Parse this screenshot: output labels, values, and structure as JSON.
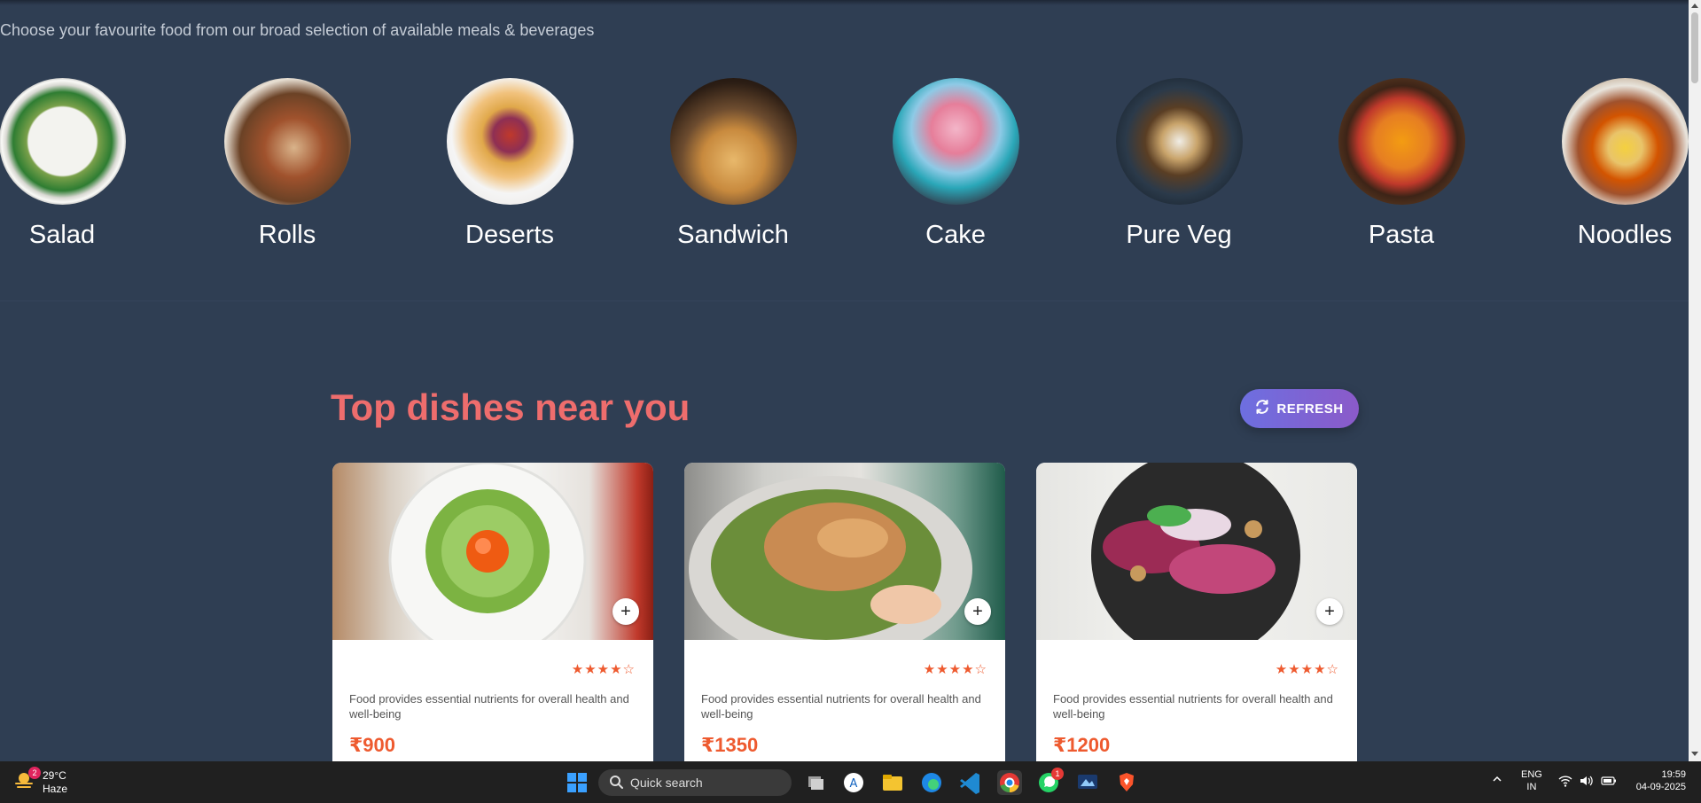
{
  "tagline": "Choose your favourite food from our broad selection of available meals & beverages",
  "categories": [
    {
      "name": "Salad"
    },
    {
      "name": "Rolls"
    },
    {
      "name": "Deserts"
    },
    {
      "name": "Sandwich"
    },
    {
      "name": "Cake"
    },
    {
      "name": "Pure Veg"
    },
    {
      "name": "Pasta"
    },
    {
      "name": "Noodles"
    }
  ],
  "section": {
    "title": "Top dishes near you",
    "refresh_label": "REFRESH"
  },
  "dishes": [
    {
      "rating": 4,
      "rating_display": "★★★★☆",
      "description": "Food provides essential nutrients for overall health and well-being",
      "price": "₹900"
    },
    {
      "rating": 4,
      "rating_display": "★★★★☆",
      "description": "Food provides essential nutrients for overall health and well-being",
      "price": "₹1350"
    },
    {
      "rating": 4,
      "rating_display": "★★★★☆",
      "description": "Food provides essential nutrients for overall health and well-being",
      "price": "₹1200"
    }
  ],
  "add_label": "+",
  "colors": {
    "page_bg": "#2f3e53",
    "accent_title": "#ee6d6d",
    "price": "#ee5a2f",
    "refresh_gradient_start": "#6d6fe0",
    "refresh_gradient_end": "#8b5ac9"
  },
  "taskbar": {
    "weather_temp": "29°C",
    "weather_desc": "Haze",
    "weather_badge": "2",
    "search_placeholder": "Quick search",
    "whatsapp_badge": "1",
    "lang_line1": "ENG",
    "lang_line2": "IN",
    "time": "19:59",
    "date": "04-09-2025",
    "icons": [
      "windows-start-icon",
      "task-view-icon",
      "app-store-icon",
      "file-explorer-icon",
      "edge-icon",
      "vscode-icon",
      "chrome-icon",
      "whatsapp-icon",
      "remote-desktop-icon",
      "brave-icon"
    ]
  }
}
